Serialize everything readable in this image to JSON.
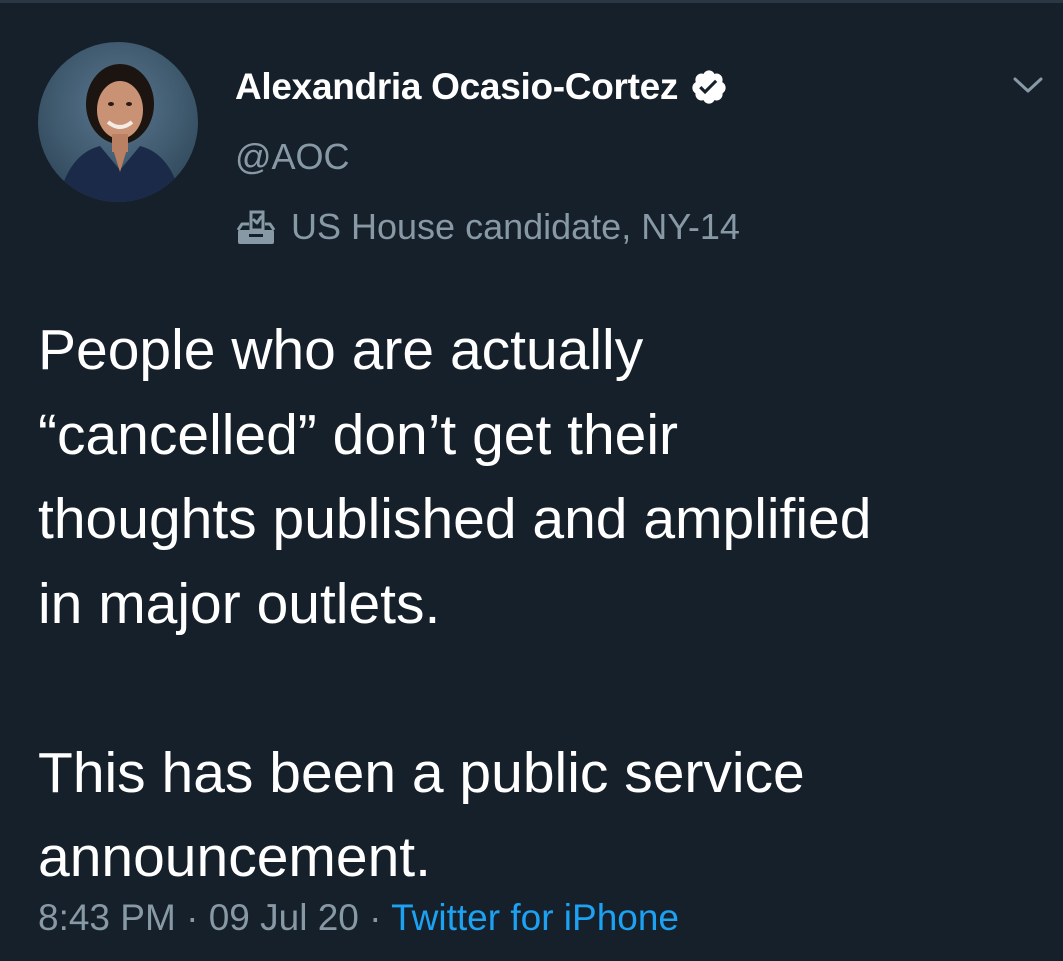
{
  "tweet": {
    "author": {
      "display_name": "Alexandria Ocasio-Cortez",
      "handle": "@AOC",
      "verified": true,
      "label": "US House candidate, NY-14",
      "label_icon": "ballot-box-icon"
    },
    "text": "People who are actually\n“cancelled” don’t get their\nthoughts published and amplified\nin major outlets.\n\nThis has been a public service\nannouncement.",
    "time": "8:43 PM",
    "date": "09 Jul 20",
    "source": "Twitter for iPhone",
    "separator": "·"
  },
  "colors": {
    "background": "#16202b",
    "primary_text": "#ffffff",
    "secondary_text": "#8899a6",
    "link": "#1da1f2"
  },
  "icons": {
    "verified": "verified-badge-icon",
    "menu": "chevron-down-icon"
  }
}
